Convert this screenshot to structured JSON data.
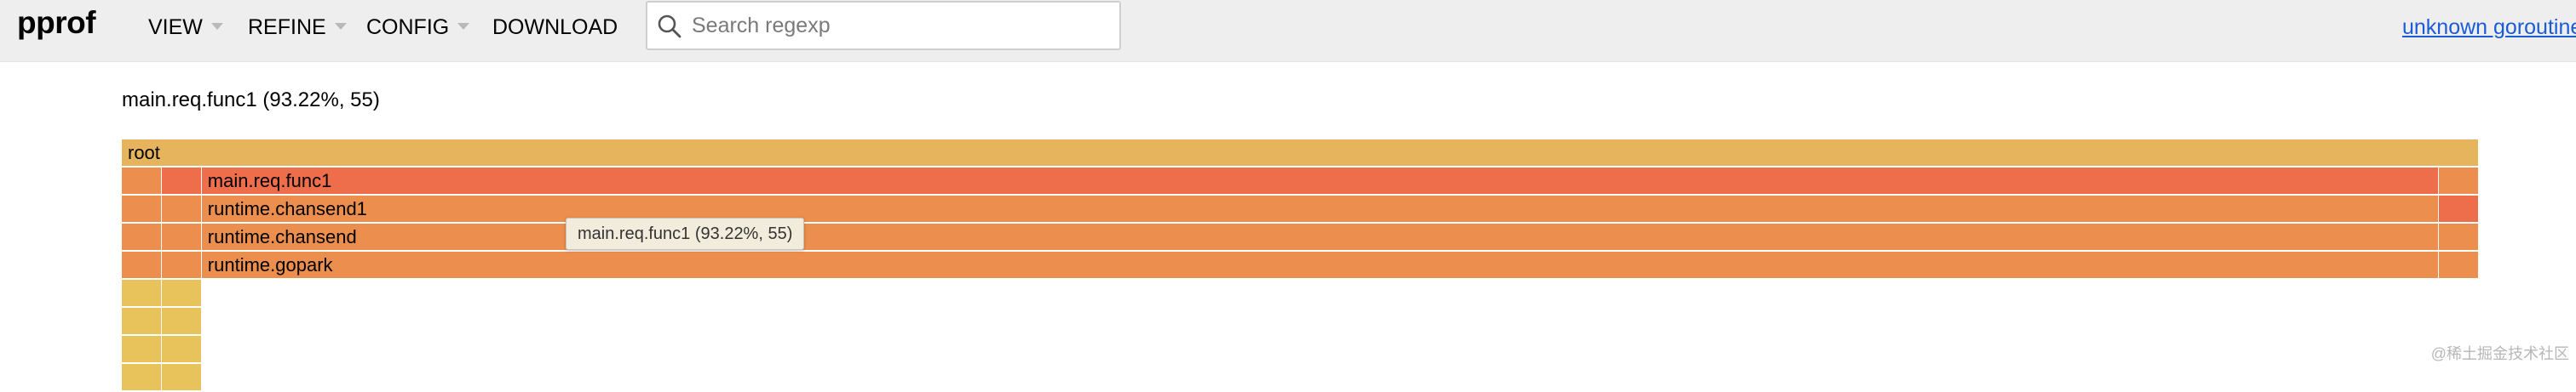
{
  "header": {
    "logo": "pprof",
    "menus": [
      {
        "label": "VIEW"
      },
      {
        "label": "REFINE"
      },
      {
        "label": "CONFIG"
      }
    ],
    "download_label": "DOWNLOAD",
    "search": {
      "placeholder": "Search regexp",
      "value": ""
    },
    "link_text": "unknown goroutine"
  },
  "details_text": "main.req.func1 (93.22%, 55)",
  "flamegraph": {
    "colors": {
      "root": "#e6b45c",
      "orange": "#ec8f4e",
      "red": "#ee6e4c",
      "yellow": "#e8c25a"
    },
    "frames": [
      {
        "name": "root",
        "color": "root",
        "depth": 0,
        "start": 0,
        "fraction": 1.0
      },
      {
        "name": "",
        "color": "orange",
        "depth": 1,
        "start": 0,
        "fraction": 0.0169
      },
      {
        "name": "",
        "color": "red",
        "depth": 1,
        "start": 0.0169,
        "fraction": 0.0169
      },
      {
        "name": "main.req.func1",
        "color": "red",
        "depth": 1,
        "start": 0.0339,
        "fraction": 0.9492
      },
      {
        "name": "",
        "color": "orange",
        "depth": 1,
        "start": 0.9831,
        "fraction": 0.0169
      },
      {
        "name": "",
        "color": "orange",
        "depth": 2,
        "start": 0,
        "fraction": 0.0169
      },
      {
        "name": "",
        "color": "orange",
        "depth": 2,
        "start": 0.0169,
        "fraction": 0.0169
      },
      {
        "name": "runtime.chansend1",
        "color": "orange",
        "depth": 2,
        "start": 0.0339,
        "fraction": 0.9492
      },
      {
        "name": "",
        "color": "red",
        "depth": 2,
        "start": 0.9831,
        "fraction": 0.0169
      },
      {
        "name": "",
        "color": "orange",
        "depth": 3,
        "start": 0,
        "fraction": 0.0169
      },
      {
        "name": "",
        "color": "orange",
        "depth": 3,
        "start": 0.0169,
        "fraction": 0.0169
      },
      {
        "name": "runtime.chansend",
        "color": "orange",
        "depth": 3,
        "start": 0.0339,
        "fraction": 0.9492
      },
      {
        "name": "",
        "color": "orange",
        "depth": 3,
        "start": 0.9831,
        "fraction": 0.0169
      },
      {
        "name": "",
        "color": "orange",
        "depth": 4,
        "start": 0,
        "fraction": 0.0169
      },
      {
        "name": "",
        "color": "orange",
        "depth": 4,
        "start": 0.0169,
        "fraction": 0.0169
      },
      {
        "name": "runtime.gopark",
        "color": "orange",
        "depth": 4,
        "start": 0.0339,
        "fraction": 0.9492
      },
      {
        "name": "",
        "color": "orange",
        "depth": 4,
        "start": 0.9831,
        "fraction": 0.0169
      },
      {
        "name": "",
        "color": "yellow",
        "depth": 5,
        "start": 0,
        "fraction": 0.0169
      },
      {
        "name": "",
        "color": "yellow",
        "depth": 5,
        "start": 0.0169,
        "fraction": 0.0169
      },
      {
        "name": "",
        "color": "yellow",
        "depth": 6,
        "start": 0,
        "fraction": 0.0169
      },
      {
        "name": "",
        "color": "yellow",
        "depth": 6,
        "start": 0.0169,
        "fraction": 0.0169
      },
      {
        "name": "",
        "color": "yellow",
        "depth": 7,
        "start": 0,
        "fraction": 0.0169
      },
      {
        "name": "",
        "color": "yellow",
        "depth": 7,
        "start": 0.0169,
        "fraction": 0.0169
      },
      {
        "name": "",
        "color": "yellow",
        "depth": 8,
        "start": 0,
        "fraction": 0.0169
      },
      {
        "name": "",
        "color": "yellow",
        "depth": 8,
        "start": 0.0169,
        "fraction": 0.0169
      }
    ]
  },
  "tooltip_text": "main.req.func1 (93.22%, 55)",
  "watermark": "@稀土掘金技术社区"
}
